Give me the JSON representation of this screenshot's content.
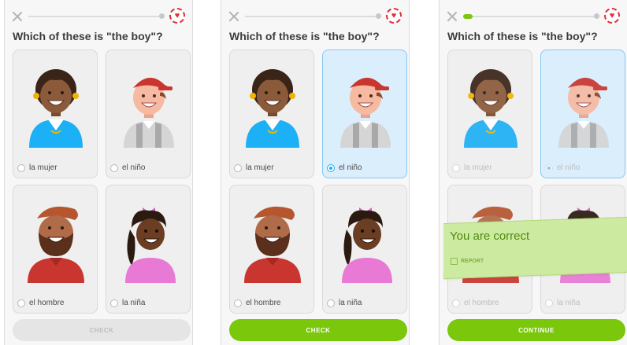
{
  "question": "Which of these is \"the boy\"?",
  "screens": [
    {
      "progress": 0,
      "selected": null,
      "button": "CHECK",
      "button_state": "disabled",
      "options": [
        "la mujer",
        "el niño",
        "el hombre",
        "la niña"
      ]
    },
    {
      "progress": 0,
      "selected": 1,
      "button": "CHECK",
      "button_state": "active",
      "options": [
        "la mujer",
        "el niño",
        "el hombre",
        "la niña"
      ]
    },
    {
      "progress": 0.07,
      "selected": 1,
      "button": "CONTINUE",
      "button_state": "active",
      "options": [
        "la mujer",
        "el niño",
        "el hombre",
        "la niña"
      ]
    }
  ],
  "feedback": {
    "title": "You are correct",
    "report": "REPORT"
  },
  "icons": {
    "close": "close-icon",
    "heart": "heart-icon",
    "flag": "flag-icon"
  },
  "colors": {
    "accent_green": "#7ac70c",
    "selected_blue": "#1cb0f6",
    "heart_red": "#e0303a"
  }
}
